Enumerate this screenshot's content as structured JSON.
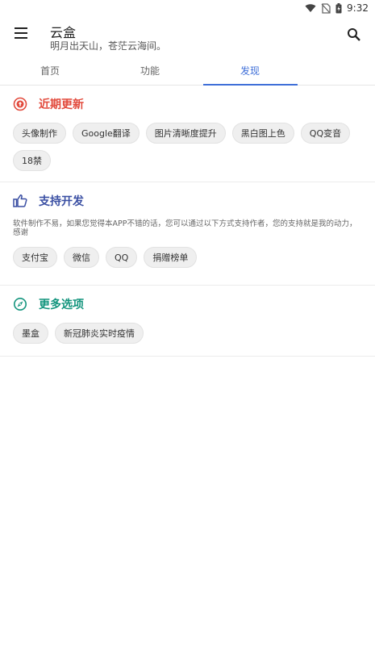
{
  "status_bar": {
    "time": "9:32"
  },
  "app_bar": {
    "title": "云盒",
    "subtitle": "明月出天山，苍茫云海间。"
  },
  "tabs": [
    {
      "label": "首页",
      "selected": false
    },
    {
      "label": "功能",
      "selected": false
    },
    {
      "label": "发现",
      "selected": true
    }
  ],
  "sections": [
    {
      "title": "近期更新",
      "color": "#e24a3c",
      "icon": "upload-circle-icon",
      "chips": [
        "头像制作",
        "Google翻译",
        "图片清晰度提升",
        "黑白图上色",
        "QQ变音",
        "18禁"
      ]
    },
    {
      "title": "支持开发",
      "color": "#3a4fa3",
      "icon": "thumb-up-icon",
      "description": "软件制作不易，如果您觉得本APP不错的话，您可以通过以下方式支持作者，您的支持就是我的动力，感谢",
      "chips": [
        "支付宝",
        "微信",
        "QQ",
        "捐赠榜单"
      ]
    },
    {
      "title": "更多选项",
      "color": "#14957e",
      "icon": "compass-icon",
      "chips": [
        "墨盒",
        "新冠肺炎实时疫情"
      ]
    }
  ],
  "colors": {
    "accent": "#3f6fd8"
  }
}
